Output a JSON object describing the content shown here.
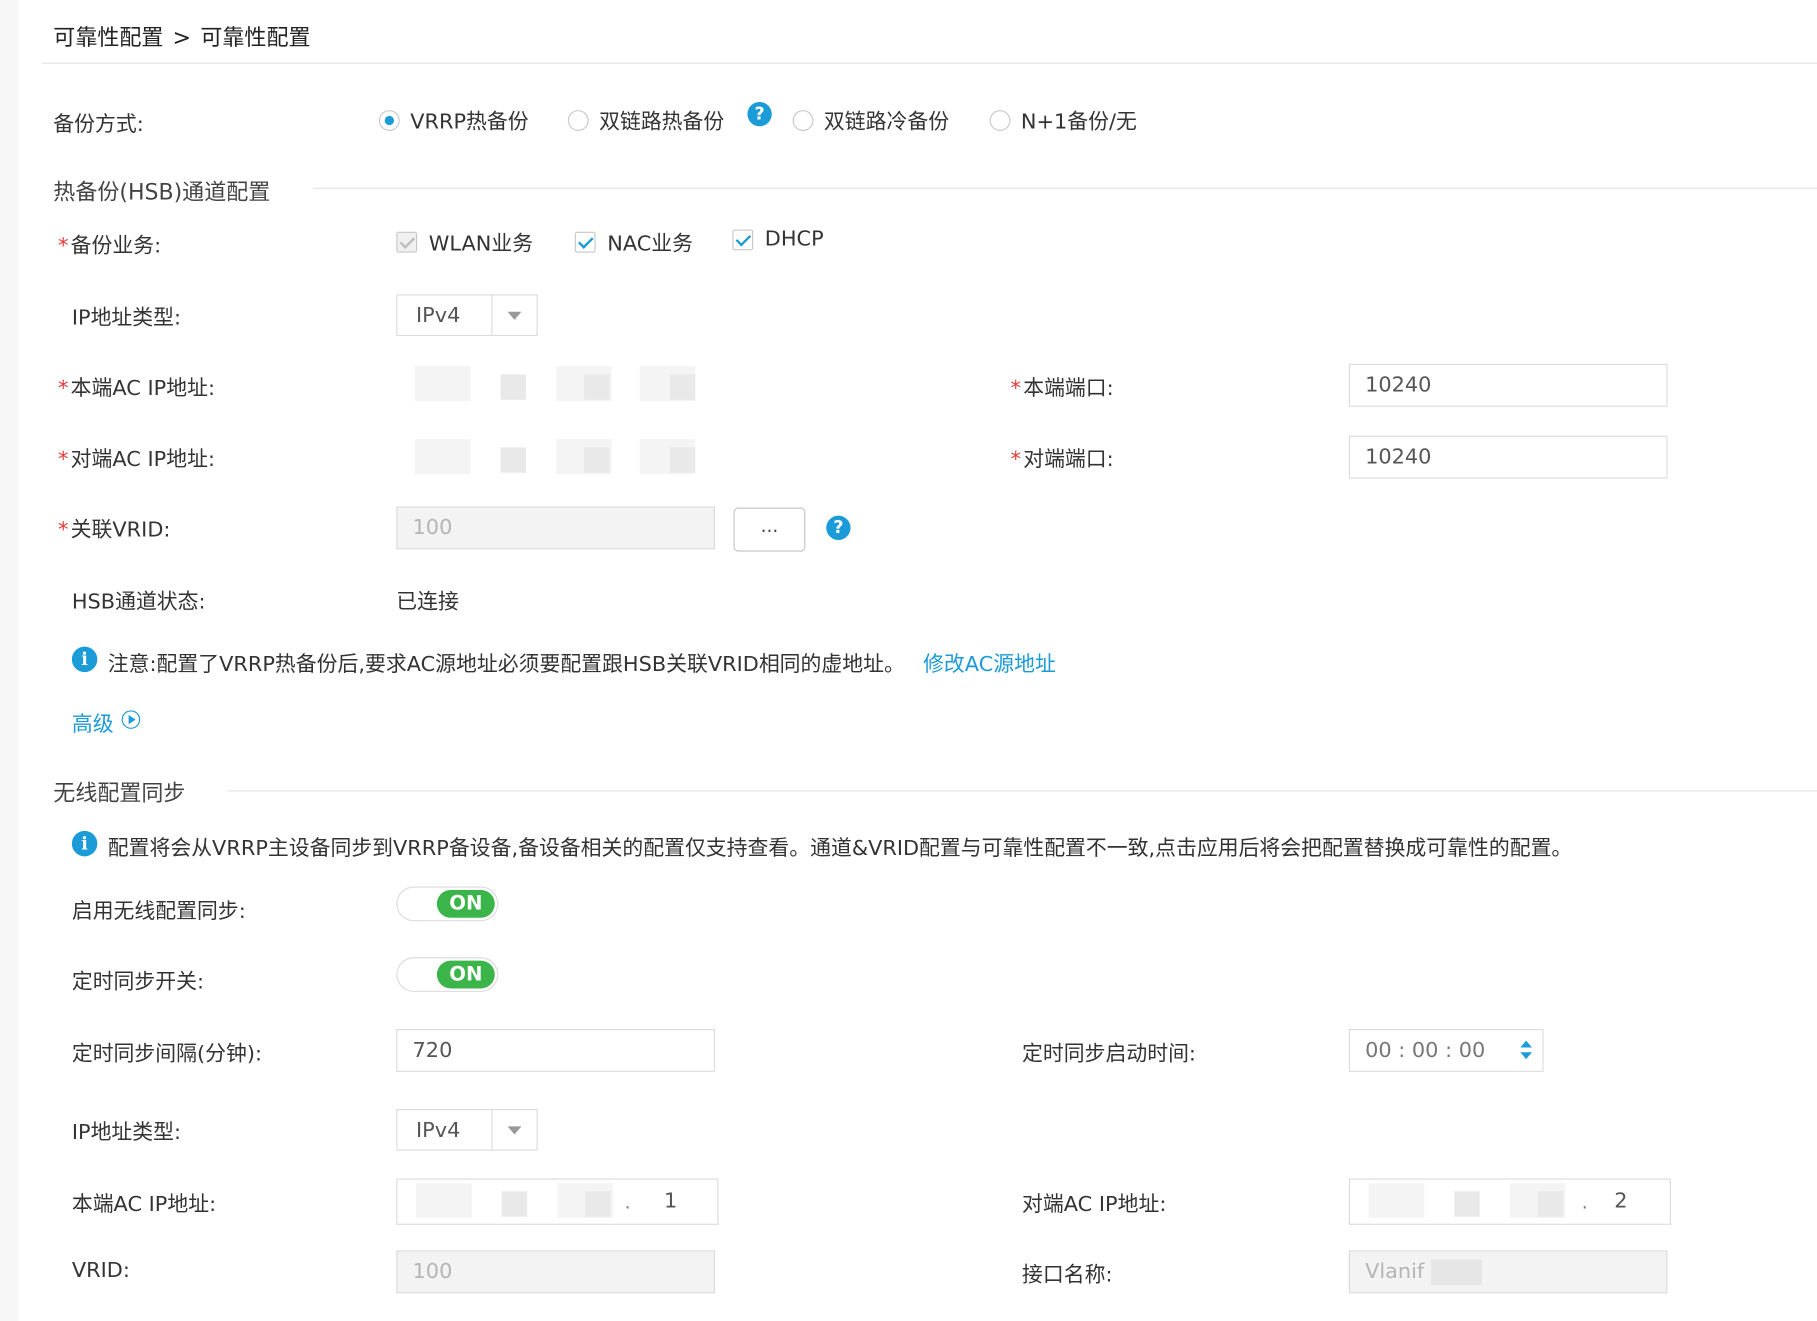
{
  "breadcrumb": {
    "parent": "可靠性配置",
    "separator": ">",
    "current": "可靠性配置"
  },
  "backup_mode": {
    "label": "备份方式:",
    "options": [
      {
        "label": "VRRP热备份",
        "selected": true
      },
      {
        "label": "双链路热备份",
        "selected": false
      },
      {
        "label": "双链路冷备份",
        "selected": false
      },
      {
        "label": "N+1备份/无",
        "selected": false
      }
    ],
    "help_icon": "?"
  },
  "hsb": {
    "section_title": "热备份(HSB)通道配置",
    "required_mark": "*",
    "backup_service_label": "备份业务:",
    "services": [
      {
        "label": "WLAN业务",
        "checked": true,
        "disabled": true
      },
      {
        "label": "NAC业务",
        "checked": true,
        "disabled": false
      },
      {
        "label": "DHCP",
        "checked": true,
        "disabled": false
      }
    ],
    "ip_type_label": "IP地址类型:",
    "ip_type_value": "IPv4",
    "local_ip_label": "本端AC IP地址:",
    "peer_ip_label": "对端AC IP地址:",
    "local_port_label": "本端端口:",
    "local_port_value": "10240",
    "peer_port_label": "对端端口:",
    "peer_port_value": "10240",
    "vrid_label": "关联VRID:",
    "vrid_value": "100",
    "vrid_button": "...",
    "status_label": "HSB通道状态:",
    "status_value": "已连接",
    "note_text": "注意:配置了VRRP热备份后,要求AC源地址必须要配置跟HSB关联VRID相同的虚地址。",
    "note_link": "修改AC源地址",
    "advanced_label": "高级"
  },
  "wireless_sync": {
    "section_title": "无线配置同步",
    "note_text": "配置将会从VRRP主设备同步到VRRP备设备,备设备相关的配置仅支持查看。通道&VRID配置与可靠性配置不一致,点击应用后将会把配置替换成可靠性的配置。",
    "enable_label": "启用无线配置同步:",
    "enable_value": "ON",
    "timer_label": "定时同步开关:",
    "timer_value": "ON",
    "interval_label": "定时同步间隔(分钟):",
    "interval_value": "720",
    "start_time_label": "定时同步启动时间:",
    "start_time_value": "00 : 00 : 00",
    "ip_type_label": "IP地址类型:",
    "ip_type_value": "IPv4",
    "local_ip_label": "本端AC IP地址:",
    "local_ip_last_octet": "1",
    "peer_ip_label": "对端AC IP地址:",
    "peer_ip_last_octet": "2",
    "vrid_label": "VRID:",
    "vrid_value": "100",
    "interface_label": "接口名称:",
    "interface_value": "Vlanif"
  },
  "colors": {
    "accent": "#1b9bd8",
    "toggle_on": "#3bb54a",
    "required": "#e53935"
  },
  "icons": [
    "help-icon",
    "info-icon",
    "arrow-right-circle-icon",
    "dropdown-arrow-icon",
    "spinner-icon",
    "radio-icon",
    "checkbox-icon"
  ]
}
